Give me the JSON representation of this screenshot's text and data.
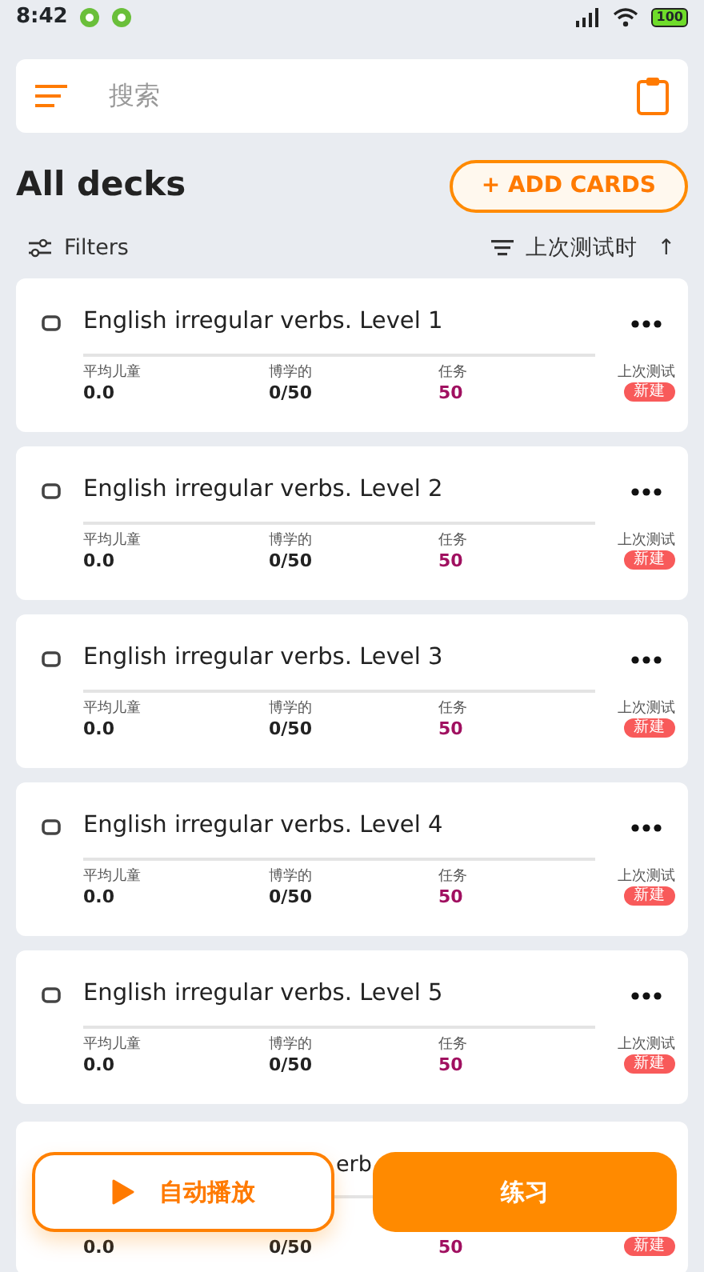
{
  "status_bar": {
    "time": "8:42",
    "battery": "100"
  },
  "search": {
    "placeholder": "搜索"
  },
  "header": {
    "title": "All decks",
    "add_button": "+ ADD CARDS"
  },
  "toolbar": {
    "filters": "Filters",
    "sort": "上次测试时",
    "sort_arrow": "↑"
  },
  "decks": [
    {
      "title": "English irregular verbs. Level 1",
      "labels": [
        "平均儿童",
        "博学的",
        "任务",
        "上次测试"
      ],
      "values": [
        "0.0",
        "0/50",
        "50"
      ],
      "badge": "新建"
    },
    {
      "title": "English irregular verbs. Level 2",
      "labels": [
        "平均儿童",
        "博学的",
        "任务",
        "上次测试"
      ],
      "values": [
        "0.0",
        "0/50",
        "50"
      ],
      "badge": "新建"
    },
    {
      "title": "English irregular verbs. Level 3",
      "labels": [
        "平均儿童",
        "博学的",
        "任务",
        "上次测试"
      ],
      "values": [
        "0.0",
        "0/50",
        "50"
      ],
      "badge": "新建"
    },
    {
      "title": "English irregular verbs. Level 4",
      "labels": [
        "平均儿童",
        "博学的",
        "任务",
        "上次测试"
      ],
      "values": [
        "0.0",
        "0/50",
        "50"
      ],
      "badge": "新建"
    },
    {
      "title": "English irregular verbs. Level 5",
      "labels": [
        "平均儿童",
        "博学的",
        "任务",
        "上次测试"
      ],
      "values": [
        "0.0",
        "0/50",
        "50"
      ],
      "badge": "新建"
    },
    {
      "title": "erb",
      "kind": "partial",
      "values": [
        "0.0",
        "0/50",
        "50"
      ],
      "badge": "新建"
    }
  ],
  "bottom_buttons": {
    "autoplay": "自动播放",
    "practice": "练习"
  }
}
